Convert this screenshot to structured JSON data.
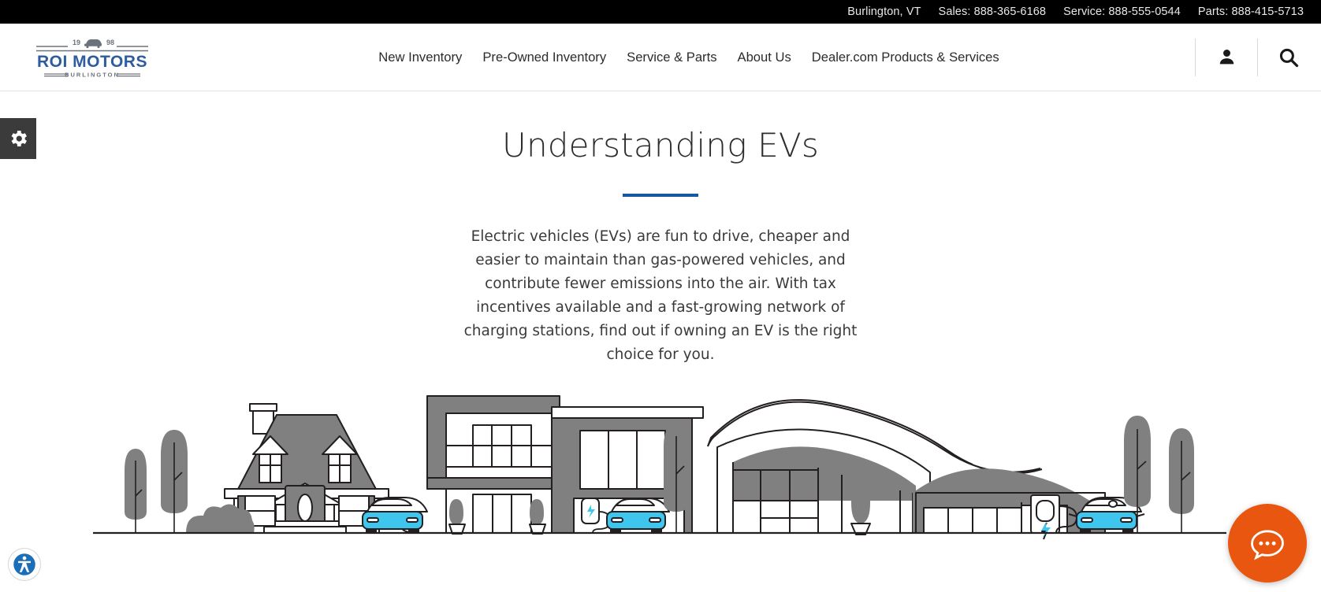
{
  "topbar": {
    "location": "Burlington, VT",
    "sales": "Sales: 888-365-6168",
    "service": "Service: 888-555-0544",
    "parts": "Parts: 888-415-5713"
  },
  "logo": {
    "name": "ROI MOTORS",
    "year_left": "19",
    "year_right": "98",
    "city": "BURLINGTON",
    "icon": "car-icon"
  },
  "nav": {
    "items": [
      {
        "label": "New Inventory",
        "name": "nav-new-inventory"
      },
      {
        "label": "Pre-Owned Inventory",
        "name": "nav-pre-owned-inventory"
      },
      {
        "label": "Service & Parts",
        "name": "nav-service-parts"
      },
      {
        "label": "About Us",
        "name": "nav-about-us"
      },
      {
        "label": "Dealer.com Products & Services",
        "name": "nav-dealercom-products-services"
      }
    ]
  },
  "header_icons": {
    "account": "person-icon",
    "search": "search-icon"
  },
  "left_tab": {
    "icon": "gear-icon",
    "label": "Settings"
  },
  "main": {
    "title": "Understanding EVs",
    "body": "Electric vehicles (EVs) are fun to drive, cheaper and easier to maintain than gas-powered vehicles, and contribute fewer emissions into the air. With tax incentives available and a fast-growing network of charging stations, find out if owning an EV is the right choice for you."
  },
  "illustration": {
    "alt": "Neighborhood street scene with houses, modern buildings, trees, EV charging stations and blue electric cars",
    "car_color": "#3fc6ef",
    "building_gray": "#808080",
    "outline": "#231f20",
    "bolt_color": "#3fc6ef"
  },
  "chat": {
    "icon": "chat-bubble-icon",
    "color": "#e8560f"
  },
  "accessibility": {
    "icon": "accessibility-icon"
  },
  "colors": {
    "accent_blue": "#1557a5",
    "logo_blue": "#2d5d9e",
    "logo_gray": "#6a737c",
    "topbar_bg": "#000000"
  }
}
